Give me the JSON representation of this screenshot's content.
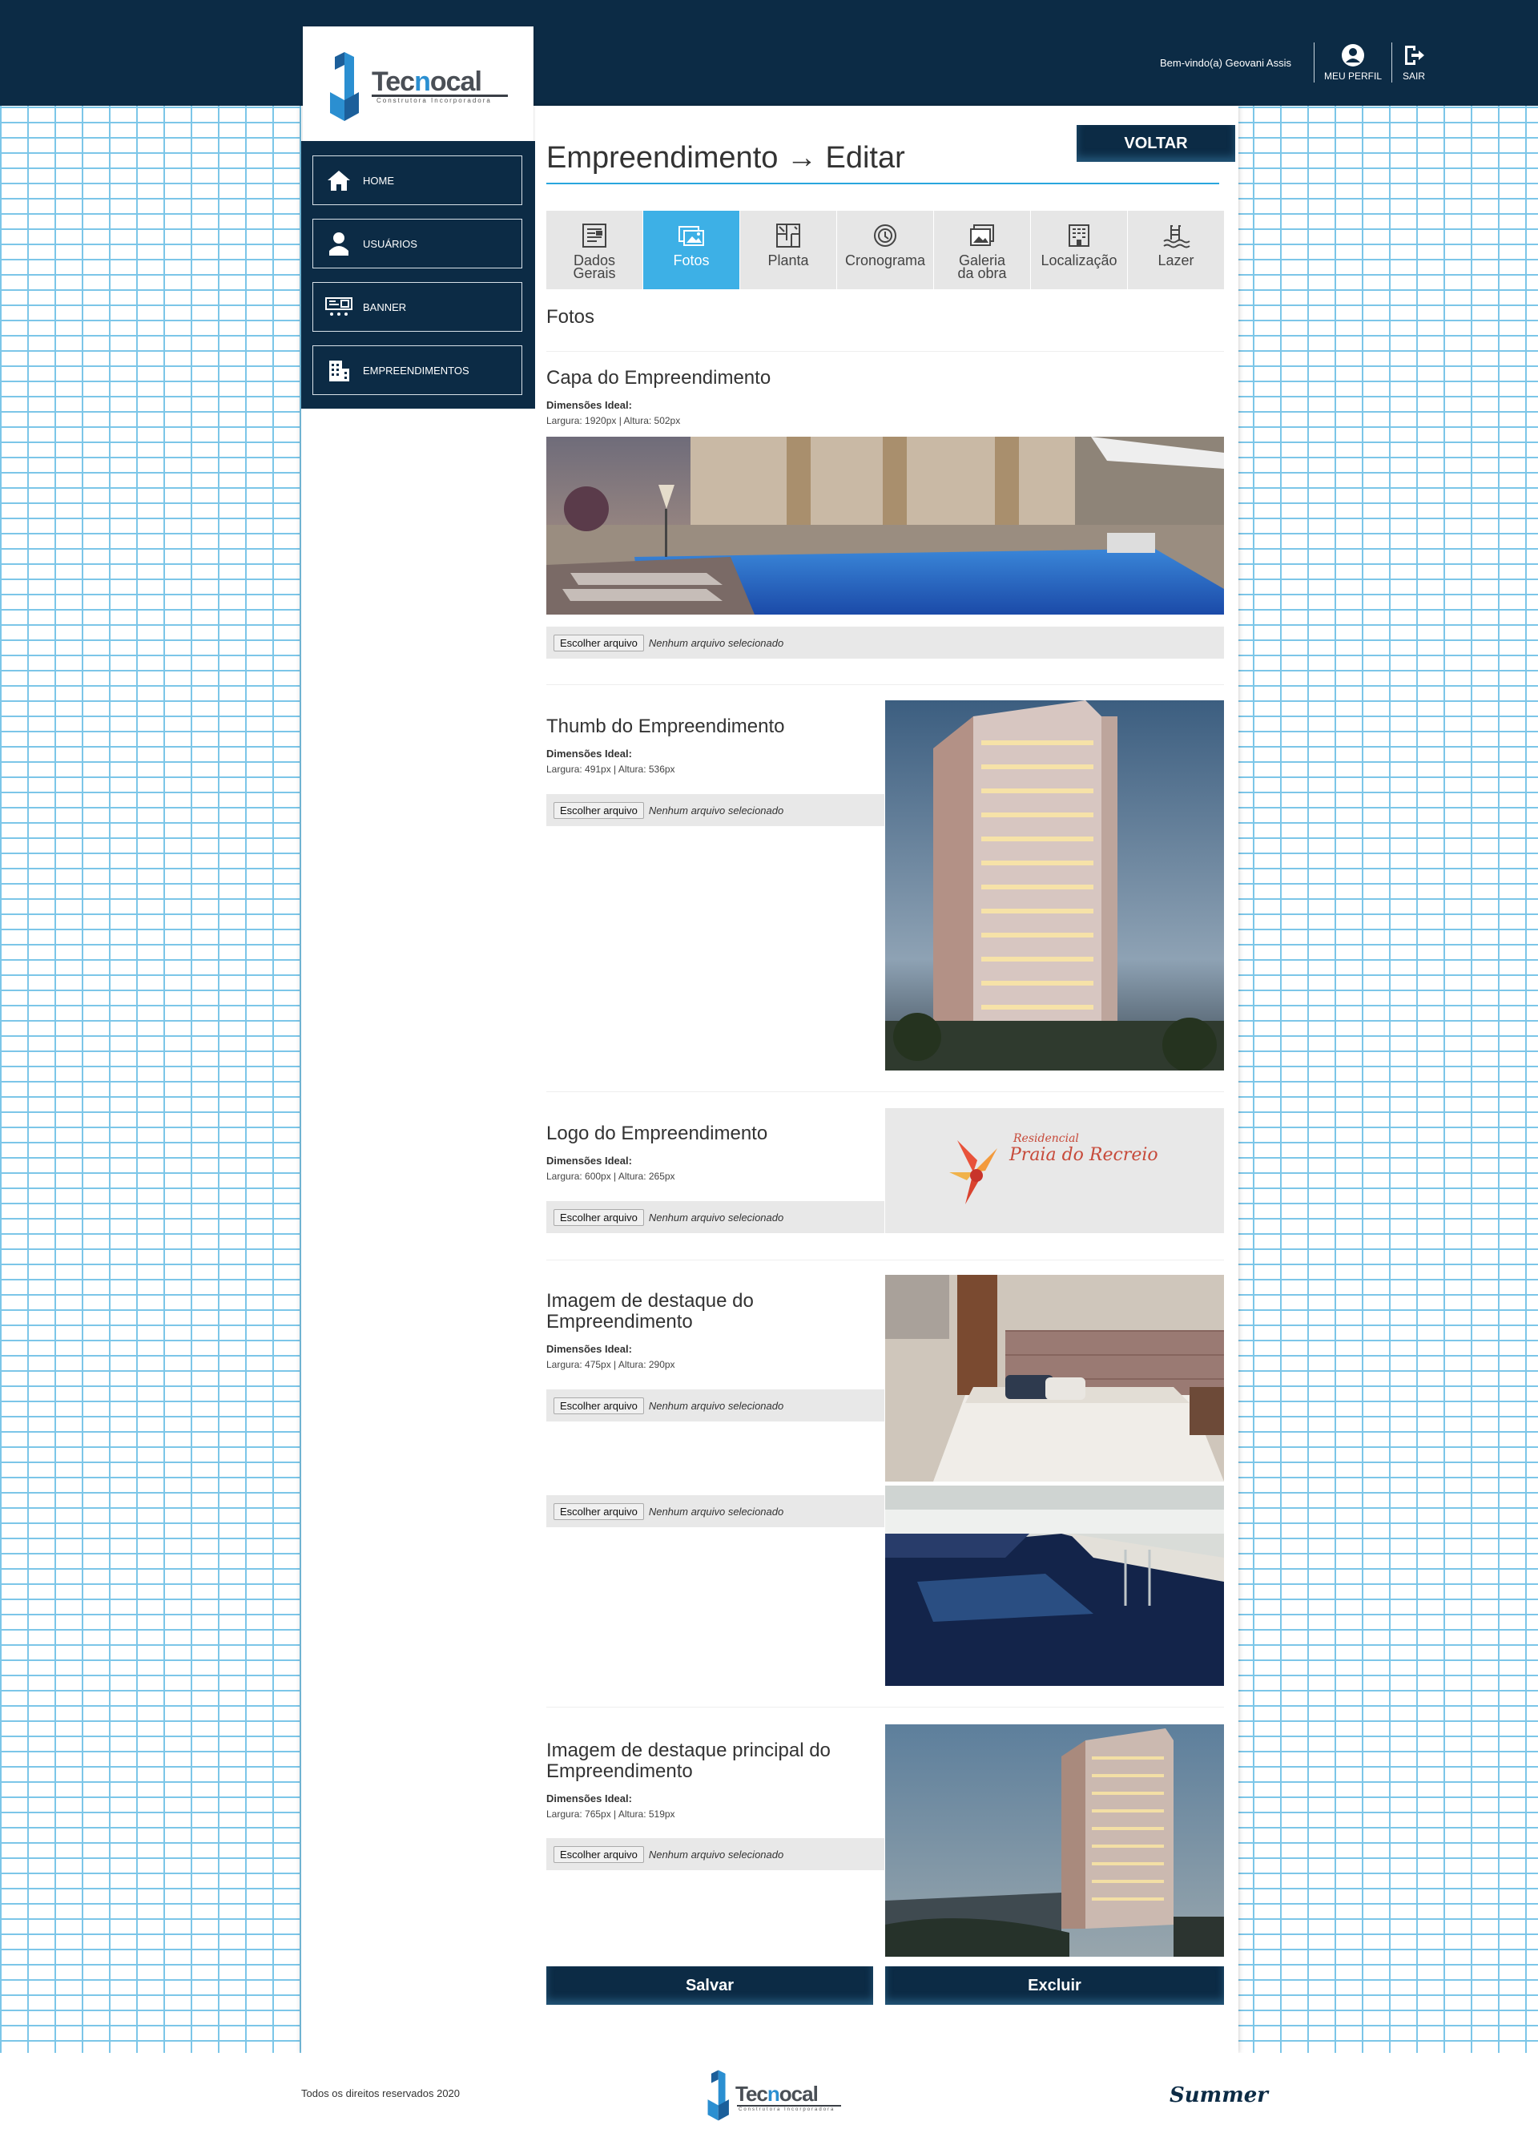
{
  "header": {
    "welcome": "Bem-vindo(a) Geovani Assis",
    "profile_label": "MEU PERFIL",
    "logout_label": "SAIR",
    "logo_text_pre": "Tec",
    "logo_text_hl": "n",
    "logo_text_post": "ocal",
    "logo_sub": "Construtora  Incorporadora"
  },
  "sidebar": {
    "items": [
      {
        "label": "HOME",
        "icon": "home-icon"
      },
      {
        "label": "USUÁRIOS",
        "icon": "user-icon"
      },
      {
        "label": "BANNER",
        "icon": "banner-icon"
      },
      {
        "label": "EMPREENDIMENTOS",
        "icon": "building-icon"
      }
    ]
  },
  "page": {
    "title": "Empreendimento → Editar",
    "back_label": "VOLTAR",
    "tabs": [
      {
        "line1": "Dados",
        "line2": "Gerais",
        "icon": "document-icon"
      },
      {
        "line1": "Fotos",
        "line2": "",
        "icon": "photos-icon"
      },
      {
        "line1": "Planta",
        "line2": "",
        "icon": "floorplan-icon"
      },
      {
        "line1": "Cronograma",
        "line2": "",
        "icon": "schedule-icon"
      },
      {
        "line1": "Galeria",
        "line2": "da obra",
        "icon": "gallery-icon"
      },
      {
        "line1": "Localização",
        "line2": "",
        "icon": "location-icon"
      },
      {
        "line1": "Lazer",
        "line2": "",
        "icon": "pool-icon"
      }
    ],
    "active_tab": "Fotos",
    "section_title": "Fotos",
    "file_button": "Escolher arquivo",
    "file_none": "Nenhum arquivo selecionado",
    "dim_label": "Dimensões Ideal:",
    "sections": {
      "capa": {
        "title": "Capa do Empreendimento",
        "dims": "Largura: 1920px | Altura: 502px"
      },
      "thumb": {
        "title": "Thumb do Empreendimento",
        "dims": "Largura: 491px | Altura: 536px"
      },
      "logo": {
        "title": "Logo do Empreendimento",
        "dims": "Largura: 600px | Altura: 265px"
      },
      "destaque": {
        "title_line1": "Imagem de destaque do",
        "title_line2": "Empreendimento",
        "dims": "Largura: 475px | Altura: 290px"
      },
      "principal": {
        "title_line1": "Imagem de destaque principal do",
        "title_line2": "Empreendimento",
        "dims": "Largura: 765px | Altura: 519px"
      }
    },
    "logo_image": {
      "line1": "Residencial",
      "line2": "Praia do Recreio"
    },
    "save_label": "Salvar",
    "delete_label": "Excluir"
  },
  "footer": {
    "copyright": "Todos os direitos reservados 2020",
    "partner": "Summer"
  },
  "colors": {
    "navy": "#0c2b45",
    "accent": "#3db0e6",
    "brick_line": "#7cc6e8"
  }
}
